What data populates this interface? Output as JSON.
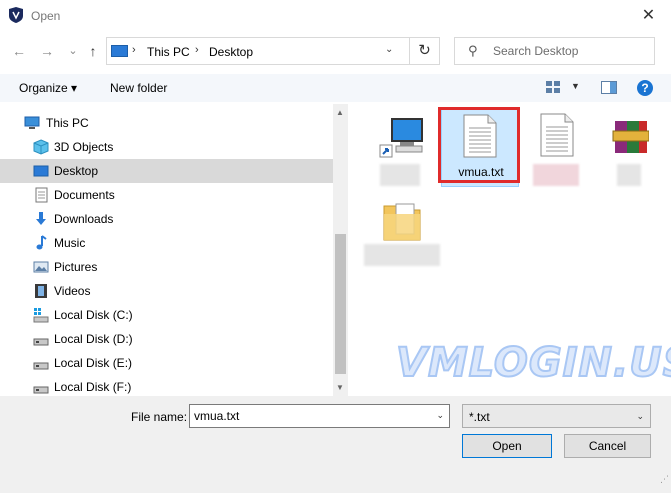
{
  "window": {
    "title": "Open",
    "close_glyph": "✕"
  },
  "nav": {
    "back_glyph": "←",
    "forward_glyph": "→",
    "recent_glyph": "⌄",
    "up_glyph": "↑",
    "breadcrumbs": [
      "This PC",
      "Desktop"
    ],
    "chevron_glyph": "›",
    "dropdown_glyph": "⌄",
    "refresh_glyph": "↻",
    "search_glyph": "⚲",
    "search_placeholder": "Search Desktop"
  },
  "toolbar": {
    "organize_label": "Organize ▾",
    "new_folder_label": "New folder",
    "view_dropdown_glyph": "▼",
    "help_glyph": "?"
  },
  "sidebar": {
    "items": [
      {
        "label": "This PC",
        "icon": "computer-icon"
      },
      {
        "label": "3D Objects",
        "icon": "cube-icon"
      },
      {
        "label": "Desktop",
        "icon": "desktop-icon",
        "selected": true
      },
      {
        "label": "Documents",
        "icon": "documents-icon"
      },
      {
        "label": "Downloads",
        "icon": "download-arrow-icon"
      },
      {
        "label": "Music",
        "icon": "music-note-icon"
      },
      {
        "label": "Pictures",
        "icon": "pictures-icon"
      },
      {
        "label": "Videos",
        "icon": "film-strip-icon"
      },
      {
        "label": "Local Disk (C:)",
        "icon": "system-drive-icon"
      },
      {
        "label": "Local Disk (D:)",
        "icon": "drive-icon"
      },
      {
        "label": "Local Disk (E:)",
        "icon": "drive-icon"
      },
      {
        "label": "Local Disk (F:)",
        "icon": "drive-icon"
      }
    ],
    "scroll_up_glyph": "▲",
    "scroll_down_glyph": "▼"
  },
  "files": [
    {
      "label": "",
      "icon": "this-pc-shortcut-icon"
    },
    {
      "label": "vmua.txt",
      "icon": "text-file-icon",
      "selected": true
    },
    {
      "label": "",
      "icon": "text-file-icon"
    },
    {
      "label": "",
      "icon": "winrar-archive-icon"
    },
    {
      "label": "",
      "icon": "folder-document-icon"
    }
  ],
  "watermark": "VMLOGIN.US",
  "bottom": {
    "file_name_label": "File name:",
    "file_name_value": "vmua.txt",
    "file_type_value": "*.txt",
    "dropdown_glyph": "⌄",
    "open_label": "Open",
    "cancel_label": "Cancel",
    "grip_glyph": "⋰"
  },
  "colors": {
    "accent": "#0078d7",
    "highlight": "#e02b2b",
    "selection": "#cce8ff",
    "watermark": "#a9c7f4"
  }
}
